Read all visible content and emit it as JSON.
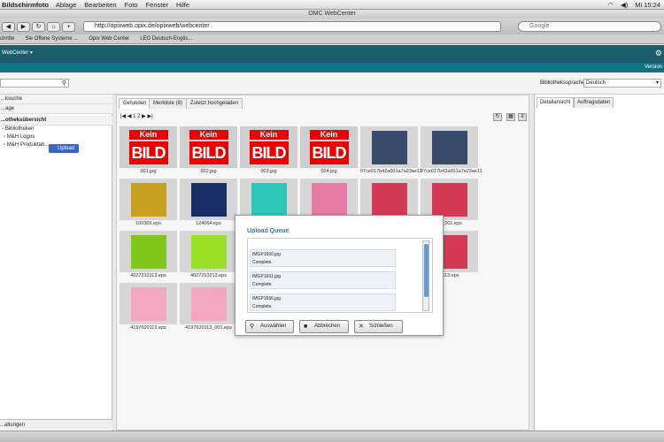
{
  "menubar": {
    "app_name": "Bildschirmfoto",
    "items": [
      "Ablage",
      "Bearbeiten",
      "Foto",
      "Fenster",
      "Hilfe"
    ],
    "clock": "Mi 15:24"
  },
  "window": {
    "title": "OMC WebCenter"
  },
  "browser": {
    "url": "http://opixweb.opix.de/opixweb/webcenter",
    "search_placeholder": "Google",
    "bookmarks": [
      "chritte",
      "Sie Offene Systeme ...",
      "Opix Web Center",
      "LEO Deutsch-Englis..."
    ]
  },
  "app": {
    "brand": "WebCenter ▾",
    "version_label": "Version",
    "library_language_label": "Bibliothekssprache",
    "library_language_value": "Deutsch"
  },
  "left": {
    "search_header": "...ksuche",
    "row2": "...age",
    "overview_header": "...otheksübersicht",
    "tree": [
      "Bibliotheken",
      "M&H Logos",
      "M&H Produktab..."
    ],
    "upload_button": "Upload",
    "footer": "...altungen"
  },
  "center": {
    "tabs": [
      "Gefunden",
      "Merkliste (8)",
      "Zuletzt hochgeladen"
    ],
    "pager": "1 2",
    "thumbs": [
      {
        "label": "001.jpg",
        "type": "keinbild"
      },
      {
        "label": "002.jpg",
        "type": "keinbild"
      },
      {
        "label": "003.jpg",
        "type": "keinbild"
      },
      {
        "label": "004.jpg",
        "type": "keinbild"
      },
      {
        "label": "07ce017b42a001a7a23ae11",
        "type": "photo",
        "color": "#3a4a6a"
      },
      {
        "label": "07ce017b42a001a7a23ae11",
        "type": "photo",
        "color": "#3a4a6a"
      },
      {
        "label": "100369.eps",
        "type": "photo",
        "color": "#c8a020"
      },
      {
        "label": "124064.eps",
        "type": "photo",
        "color": "#1a2e66"
      },
      {
        "label": "",
        "type": "photo",
        "color": "#2cc7b8"
      },
      {
        "label": "",
        "type": "photo",
        "color": "#e87aa6"
      },
      {
        "label": "",
        "type": "photo",
        "color": "#d43a55"
      },
      {
        "label": "13_001.eps",
        "type": "photo",
        "color": "#d43a55"
      },
      {
        "label": "4027210113.eps",
        "type": "photo",
        "color": "#7ec81a"
      },
      {
        "label": "4027210213.eps",
        "type": "photo",
        "color": "#9ae024"
      },
      {
        "label": "",
        "type": "blank"
      },
      {
        "label": "",
        "type": "blank"
      },
      {
        "label": "",
        "type": "blank"
      },
      {
        "label": "0113.eps",
        "type": "photo",
        "color": "#d43a55"
      },
      {
        "label": "4197620113.eps",
        "type": "photo",
        "color": "#f2a6c0"
      },
      {
        "label": "4197620113_001.eps",
        "type": "photo",
        "color": "#f2a6c0"
      }
    ],
    "kein": "Kein",
    "bild": "BILD"
  },
  "dialog": {
    "title": "Upload Queue",
    "items": [
      {
        "name": "IMGP1660.jpg",
        "status": "Complete."
      },
      {
        "name": "IMGP1661.jpg",
        "status": "Complete."
      },
      {
        "name": "IMGP1666.jpg",
        "status": "Complete."
      }
    ],
    "buttons": {
      "select": "Auswählen",
      "cancel": "Abbrechen",
      "close": "Schließen"
    }
  },
  "right": {
    "tabs": [
      "Detailansicht",
      "Auftragsdaten"
    ]
  }
}
